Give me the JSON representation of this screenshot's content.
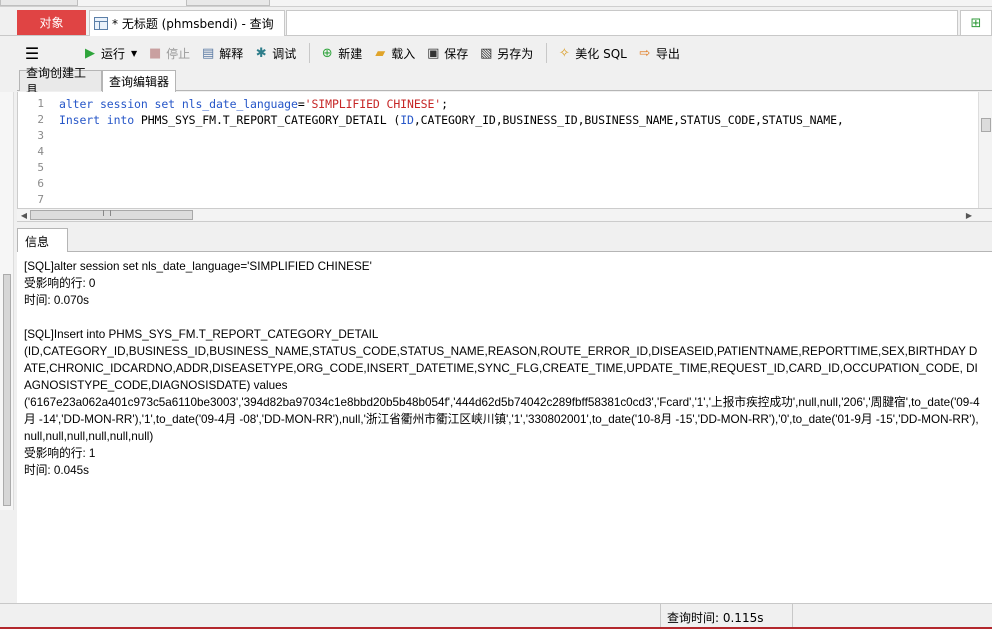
{
  "tabs": {
    "objects_label": "对象",
    "query_label": "* 无标题 (phmsbendi) - 查询"
  },
  "toolbar": {
    "run": "运行",
    "stop": "停止",
    "explain": "解释",
    "debug": "调试",
    "new": "新建",
    "load": "载入",
    "save": "保存",
    "save_as": "另存为",
    "beautify": "美化 SQL",
    "export": "导出"
  },
  "subtabs": {
    "builder": "查询创建工具",
    "editor": "查询编辑器"
  },
  "editor": {
    "line_numbers": [
      "1",
      "2",
      "3",
      "4",
      "5",
      "6",
      "7"
    ],
    "line1": {
      "kw1": "alter session set nls_date_language",
      "op": "=",
      "str": "'SIMPLIFIED CHINESE'",
      "end": ";"
    },
    "line2": {
      "kw1": "Insert into",
      "rest": " PHMS_SYS_FM.T_REPORT_CATEGORY_DETAIL (",
      "kw2": "ID",
      "cols": ",CATEGORY_ID,BUSINESS_ID,BUSINESS_NAME,STATUS_CODE,STATUS_NAME,"
    }
  },
  "info": {
    "tab_label": "信息",
    "block1": {
      "sql": "[SQL]alter session set nls_date_language='SIMPLIFIED CHINESE'",
      "affected": "受影响的行: 0",
      "time": "时间: 0.070s"
    },
    "block2": {
      "sql": "[SQL]Insert into PHMS_SYS_FM.T_REPORT_CATEGORY_DETAIL",
      "columns": "(ID,CATEGORY_ID,BUSINESS_ID,BUSINESS_NAME,STATUS_CODE,STATUS_NAME,REASON,ROUTE_ERROR_ID,DISEASEID,PATIENTNAME,REPORTTIME,SEX,BIRTHDAY DATE,CHRONIC_IDCARDNO,ADDR,DISEASETYPE,ORG_CODE,INSERT_DATETIME,SYNC_FLG,CREATE_TIME,UPDATE_TIME,REQUEST_ID,CARD_ID,OCCUPATION_CODE, DIAGNOSISTYPE_CODE,DIAGNOSISDATE) values",
      "values": "('6167e23a062a401c973c5a6110be3003','394d82ba97034c1e8bbd20b5b48b054f','444d62d5b74042c289fbff58381c0cd3','Fcard','1','上报市疾控成功',null,null,'206','周腱宿',to_date('09-4月 -14','DD-MON-RR'),'1',to_date('09-4月 -08','DD-MON-RR'),null,'浙江省衢州市衢江区峡川镇','1','330802001',to_date('10-8月 -15','DD-MON-RR'),'0',to_date('01-9月 -15','DD-MON-RR'),null,null,null,null,null,null)",
      "affected": "受影响的行: 1",
      "time": "时间: 0.045s"
    }
  },
  "status": {
    "query_time": "查询时间: 0.115s"
  },
  "colors": {
    "active_tab": "#e04444",
    "keyword": "#2757c8",
    "string": "#c62626",
    "status_line": "#b3282d"
  }
}
